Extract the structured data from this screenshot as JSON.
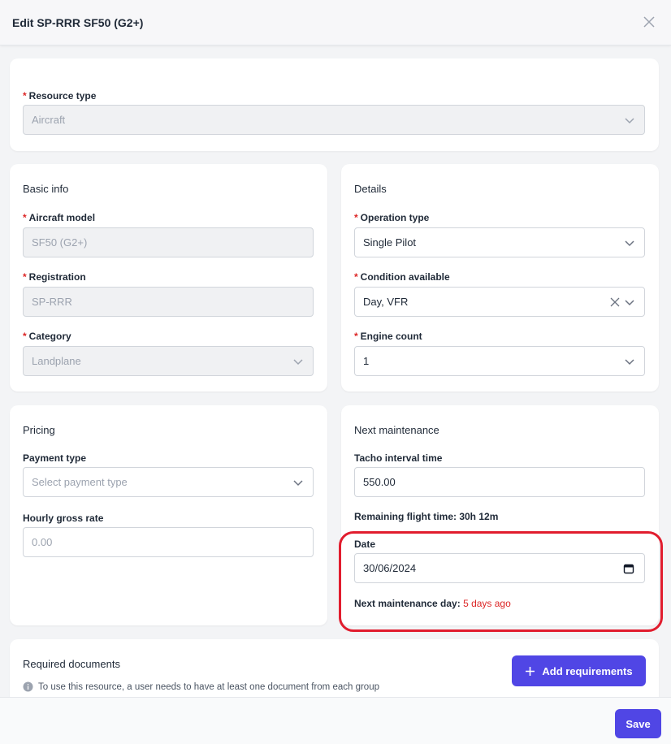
{
  "header": {
    "title": "Edit SP-RRR SF50 (G2+)"
  },
  "resource": {
    "label": "Resource type",
    "value": "Aircraft"
  },
  "basic_info": {
    "title": "Basic info",
    "aircraft_model": {
      "label": "Aircraft model",
      "value": "SF50 (G2+)"
    },
    "registration": {
      "label": "Registration",
      "value": "SP-RRR"
    },
    "category": {
      "label": "Category",
      "value": "Landplane"
    }
  },
  "details": {
    "title": "Details",
    "operation_type": {
      "label": "Operation type",
      "value": "Single Pilot"
    },
    "condition_available": {
      "label": "Condition available",
      "value": "Day, VFR"
    },
    "engine_count": {
      "label": "Engine count",
      "value": "1"
    }
  },
  "pricing": {
    "title": "Pricing",
    "payment_type": {
      "label": "Payment type",
      "placeholder": "Select payment type"
    },
    "hourly_rate": {
      "label": "Hourly gross rate",
      "placeholder": "0.00"
    }
  },
  "maintenance": {
    "title": "Next maintenance",
    "tacho": {
      "label": "Tacho interval time",
      "value": "550.00"
    },
    "remaining": "Remaining flight time: 30h 12m",
    "date": {
      "label": "Date",
      "value": "30/06/2024"
    },
    "next_day_label": "Next maintenance day:",
    "next_day_value": "5 days ago"
  },
  "documents": {
    "title": "Required documents",
    "info": "To use this resource, a user needs to have at least one document from each group",
    "add_button": "Add requirements"
  },
  "footer": {
    "save_label": "Save"
  },
  "colors": {
    "accent": "#5046e5",
    "required": "#dc2626",
    "highlight": "#e11d2e"
  }
}
